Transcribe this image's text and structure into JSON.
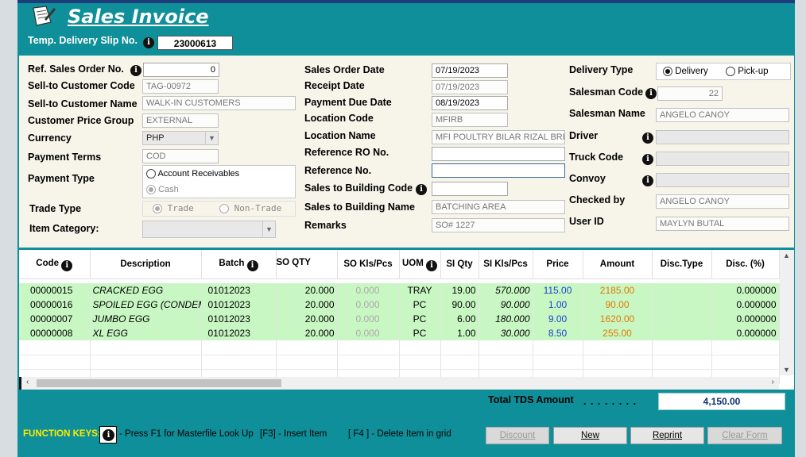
{
  "window": {
    "title": "Sales Invoice"
  },
  "header": {
    "slip_label": "Temp. Delivery Slip No.",
    "slip_value": "23000613"
  },
  "col1": {
    "ref_so_label": "Ref. Sales Order No.",
    "ref_so_value": "0",
    "cust_code_label": "Sell-to Customer Code",
    "cust_code_value": "TAG-00972",
    "cust_name_label": "Sell-to Customer Name",
    "cust_name_value": "WALK-IN CUSTOMERS",
    "price_group_label": "Customer Price Group",
    "price_group_value": "EXTERNAL",
    "currency_label": "Currency",
    "currency_value": "PHP",
    "terms_label": "Payment Terms",
    "terms_value": "COD",
    "pay_type_label": "Payment Type",
    "pay_opt1": "Account Receivables",
    "pay_opt2": "Cash",
    "trade_label": "Trade Type",
    "trade_opt1": "Trade",
    "trade_opt2": "Non-Trade",
    "item_cat_label": "Item Category:",
    "item_cat_value": ""
  },
  "col2": {
    "so_date_label": "Sales Order Date",
    "so_date_value": "07/19/2023",
    "receipt_label": "Receipt Date",
    "receipt_value": "07/19/2023",
    "due_label": "Payment Due Date",
    "due_value": "08/19/2023",
    "loc_code_label": "Location Code",
    "loc_code_value": "MFIRB",
    "loc_name_label": "Location Name",
    "loc_name_value": "MFI POULTRY BILAR RIZAL BREEDER",
    "ref_ro_label": "Reference RO No.",
    "ref_ro_value": "",
    "ref_no_label": "Reference No.",
    "ref_no_value": "",
    "bldg_code_label": "Sales to Building Code",
    "bldg_code_value": "",
    "bldg_name_label": "Sales to Building Name",
    "bldg_name_value": "BATCHING AREA",
    "remarks_label": "Remarks",
    "remarks_value": "SO# 1227"
  },
  "col3": {
    "delivery_label": "Delivery Type",
    "delivery_opt1": "Delivery",
    "delivery_opt2": "Pick-up",
    "sm_code_label": "Salesman Code",
    "sm_code_value": "22",
    "sm_name_label": "Salesman Name",
    "sm_name_value": "ANGELO CANOY",
    "driver_label": "Driver",
    "driver_value": "",
    "truck_label": "Truck Code",
    "truck_value": "",
    "convoy_label": "Convoy",
    "convoy_value": "",
    "checked_label": "Checked by",
    "checked_value": "ANGELO CANOY",
    "user_label": "User ID",
    "user_value": "MAYLYN BUTAL"
  },
  "grid": {
    "columns": [
      "Code",
      "Description",
      "Batch",
      "SO QTY",
      "SO Kls/Pcs",
      "UOM",
      "SI Qty",
      "SI Kls/Pcs",
      "Price",
      "Amount",
      "Disc.Type",
      "Disc. (%)"
    ],
    "rows": [
      [
        "00000015",
        "CRACKED EGG",
        "01012023",
        "20.000",
        "0.000",
        "TRAY",
        "19.00",
        "570.000",
        "115.00",
        "2185.00",
        "",
        "0.000000"
      ],
      [
        "00000016",
        "SPOILED EGG (CONDEMNED)",
        "01012023",
        "20.000",
        "0.000",
        "PC",
        "90.00",
        "90.000",
        "1.00",
        "90.00",
        "",
        "0.000000"
      ],
      [
        "00000007",
        "JUMBO EGG",
        "01012023",
        "20.000",
        "0.000",
        "PC",
        "6.00",
        "180.000",
        "9.00",
        "1620.00",
        "",
        "0.000000"
      ],
      [
        "00000008",
        "XL EGG",
        "01012023",
        "20.000",
        "0.000",
        "PC",
        "1.00",
        "30.000",
        "8.50",
        "255.00",
        "",
        "0.000000"
      ]
    ]
  },
  "totals": {
    "label": "Total TDS Amount",
    "dots": ". . . . . . . .",
    "value": "4,150.00"
  },
  "footer": {
    "fk_label": "FUNCTION KEYS:",
    "fk1": "- Press F1 for Masterfile Look Up",
    "fk2": "[F3] - Insert Item",
    "fk3": "[ F4 ] - Delete Item in grid",
    "buttons": {
      "discount": "Discount",
      "new": "New",
      "reprint": "Reprint",
      "clear": "Clear Form"
    }
  },
  "icons": {
    "info": "info-icon",
    "logo": "invoice-doc-icon",
    "dropdown": "chevron-down-icon"
  },
  "colors": {
    "window": "#0f8f99",
    "panel": "#f7f5ea",
    "row": "#c9f7c4",
    "price": "#1a3fd0",
    "amount": "#e07a00"
  }
}
